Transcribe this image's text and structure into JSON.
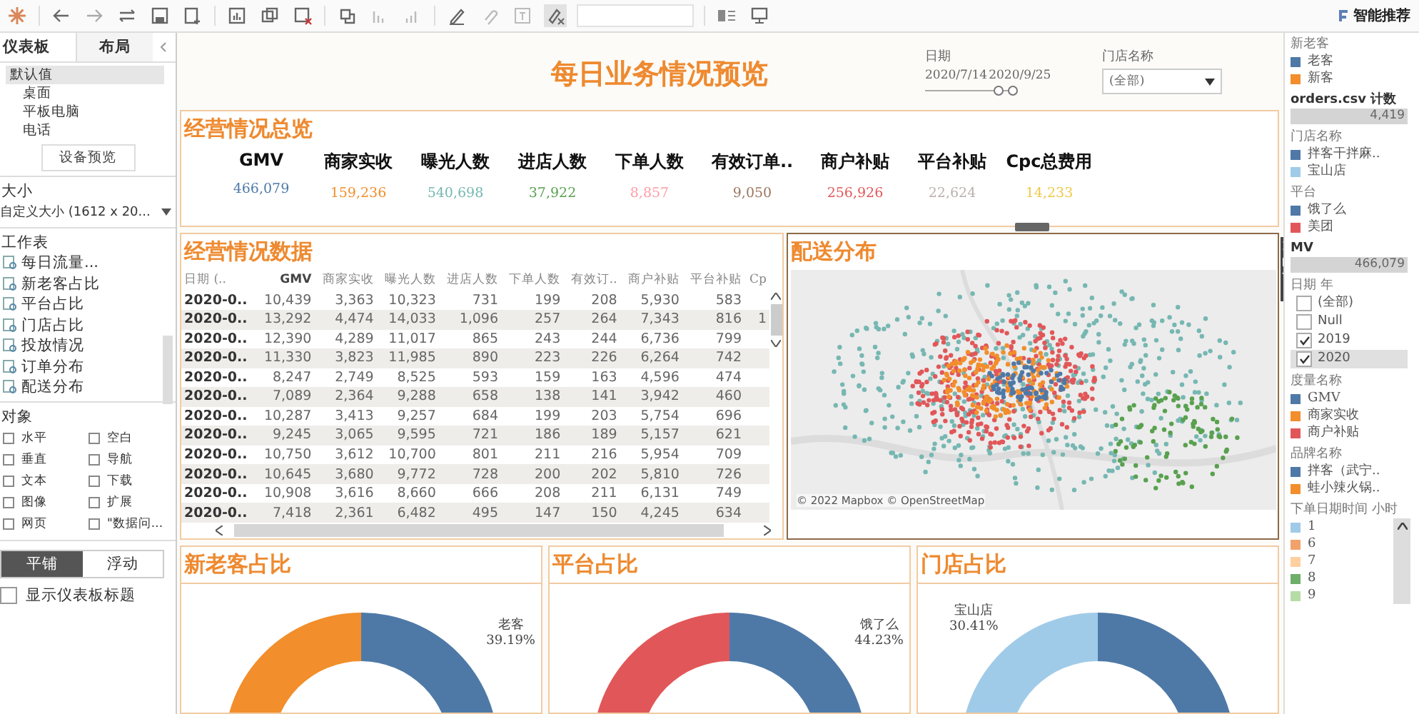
{
  "toolbar": {
    "recommend_button": "智能推荐"
  },
  "left_panel": {
    "tabs": [
      {
        "label": "仪表板",
        "selected": true
      },
      {
        "label": "布局",
        "selected": false
      }
    ],
    "devices": [
      {
        "label": "默认值",
        "selected": true
      },
      {
        "label": "桌面",
        "selected": false
      },
      {
        "label": "平板电脑",
        "selected": false
      },
      {
        "label": "电话",
        "selected": false
      }
    ],
    "preview_button": "设备预览",
    "size_label": "大小",
    "size_value": "自定义大小 (1612 x 20...",
    "sheets_label": "工作表",
    "sheets": [
      "每日流量...",
      "新老客占比",
      "平台占比",
      "门店占比",
      "投放情况",
      "订单分布",
      "配送分布"
    ],
    "objects_label": "对象",
    "objects": [
      "水平",
      "空白",
      "垂直",
      "导航",
      "文本",
      "下载",
      "图像",
      "扩展",
      "网页",
      "\"数据问..."
    ],
    "mode_tabs": [
      {
        "label": "平铺",
        "selected": true
      },
      {
        "label": "浮动",
        "selected": false
      }
    ],
    "show_title": {
      "label": "显示仪表板标题",
      "checked": false
    }
  },
  "dashboard": {
    "title": "每日业务情况预览",
    "date_filter": {
      "label": "日期",
      "start": "2020/7/14",
      "end": "2020/9/25",
      "thumbs": [
        {
          "level": 0.8
        },
        {
          "level": 0.95
        }
      ]
    },
    "store_filter": {
      "label": "门店名称",
      "value": "(全部)"
    },
    "overview": {
      "title": "经营情况总览",
      "kpis": [
        {
          "label": "GMV",
          "value": "466,079",
          "color": "#4e79a7"
        },
        {
          "label": "商家实收",
          "value": "159,236",
          "color": "#f28e2b"
        },
        {
          "label": "曝光人数",
          "value": "540,698",
          "color": "#76b7b2"
        },
        {
          "label": "进店人数",
          "value": "37,922",
          "color": "#59a14f"
        },
        {
          "label": "下单人数",
          "value": "8,857",
          "color": "#ff9da7"
        },
        {
          "label": "有效订单..",
          "value": "9,050",
          "color": "#9c755f"
        },
        {
          "label": "商户补贴",
          "value": "256,926",
          "color": "#e15759"
        },
        {
          "label": "平台补贴",
          "value": "22,624",
          "color": "#bab0ac"
        },
        {
          "label": "Cpc总费用",
          "value": "14,233",
          "color": "#edc948"
        }
      ]
    },
    "table": {
      "title": "经营情况数据",
      "columns": [
        "日期 (..",
        "GMV",
        "商家实收",
        "曝光人数",
        "进店人数",
        "下单人数",
        "有效订..",
        "商户补贴",
        "平台补贴",
        "Cp"
      ],
      "rows": [
        [
          "2020-0..",
          "10,439",
          "3,363",
          "10,323",
          "731",
          "199",
          "208",
          "5,930",
          "583"
        ],
        [
          "2020-0..",
          "13,292",
          "4,474",
          "14,033",
          "1,096",
          "257",
          "264",
          "7,343",
          "816",
          "1"
        ],
        [
          "2020-0..",
          "12,390",
          "4,289",
          "11,017",
          "865",
          "243",
          "244",
          "6,736",
          "799"
        ],
        [
          "2020-0..",
          "11,330",
          "3,823",
          "11,985",
          "890",
          "223",
          "226",
          "6,264",
          "742"
        ],
        [
          "2020-0..",
          "8,247",
          "2,749",
          "8,525",
          "593",
          "159",
          "163",
          "4,596",
          "474"
        ],
        [
          "2020-0..",
          "7,089",
          "2,364",
          "9,288",
          "658",
          "138",
          "141",
          "3,942",
          "460"
        ],
        [
          "2020-0..",
          "10,287",
          "3,413",
          "9,257",
          "684",
          "199",
          "203",
          "5,754",
          "696"
        ],
        [
          "2020-0..",
          "9,245",
          "3,065",
          "9,595",
          "721",
          "186",
          "189",
          "5,157",
          "621"
        ],
        [
          "2020-0..",
          "10,750",
          "3,612",
          "10,700",
          "801",
          "211",
          "216",
          "5,954",
          "709"
        ],
        [
          "2020-0..",
          "10,645",
          "3,680",
          "9,772",
          "728",
          "200",
          "202",
          "5,810",
          "726"
        ],
        [
          "2020-0..",
          "10,908",
          "3,616",
          "8,660",
          "666",
          "208",
          "211",
          "6,131",
          "749"
        ],
        [
          "2020-0..",
          "7,418",
          "2,361",
          "6,482",
          "495",
          "147",
          "150",
          "4,245",
          "634"
        ]
      ]
    },
    "map": {
      "title": "配送分布",
      "attribution": "© 2022 Mapbox © OpenStreetMap"
    },
    "donuts": [
      {
        "title": "新老客占比",
        "segments": [
          {
            "color": "#f28e2b"
          },
          {
            "color": "#4e79a7",
            "label": "老客",
            "percent": "39.19%"
          }
        ]
      },
      {
        "title": "平台占比",
        "segments": [
          {
            "color": "#e15759"
          },
          {
            "color": "#4e79a7",
            "label": "饿了么",
            "percent": "44.23%"
          }
        ]
      },
      {
        "title": "门店占比",
        "segments": [
          {
            "color": "#a0cbe8",
            "label": "宝山店",
            "percent": "30.41%"
          },
          {
            "color": "#4e79a7"
          }
        ]
      }
    ]
  },
  "right_panel": [
    {
      "kind": "legend",
      "title": "新老客",
      "items": [
        {
          "label": "老客",
          "color": "#4e79a7"
        },
        {
          "label": "新客",
          "color": "#f28e2b"
        }
      ]
    },
    {
      "kind": "bar",
      "title": "orders.csv 计数",
      "value": "4,419"
    },
    {
      "kind": "legend",
      "title": "门店名称",
      "items": [
        {
          "label": "拌客干拌麻..",
          "color": "#4e79a7"
        },
        {
          "label": "宝山店",
          "color": "#a0cbe8"
        }
      ]
    },
    {
      "kind": "legend",
      "title": "平台",
      "items": [
        {
          "label": "饿了么",
          "color": "#4e79a7"
        },
        {
          "label": "美团",
          "color": "#e15759"
        }
      ]
    },
    {
      "kind": "bar",
      "title": "MV",
      "value": "466,079"
    },
    {
      "kind": "checklist",
      "title": "日期 年",
      "items": [
        {
          "label": "(全部)",
          "checked": false,
          "selected": false
        },
        {
          "label": "Null",
          "checked": false,
          "selected": false
        },
        {
          "label": "2019",
          "checked": true,
          "selected": false
        },
        {
          "label": "2020",
          "checked": true,
          "selected": true
        }
      ]
    },
    {
      "kind": "legend",
      "title": "度量名称",
      "items": [
        {
          "label": "GMV",
          "color": "#4e79a7"
        },
        {
          "label": "商家实收",
          "color": "#f28e2b"
        },
        {
          "label": "商户补贴",
          "color": "#e15759"
        }
      ]
    },
    {
      "kind": "legend",
      "title": "品牌名称",
      "items": [
        {
          "label": "拌客（武宁..",
          "color": "#4e79a7"
        },
        {
          "label": "蛙小辣火锅..",
          "color": "#f28e2b"
        }
      ]
    },
    {
      "kind": "legend",
      "title": "下单日期时间 小时",
      "scroll": true,
      "items": [
        {
          "label": "1",
          "color": "#a0cbe8"
        },
        {
          "label": "6",
          "color": "#f1a26b"
        },
        {
          "label": "7",
          "color": "#ffcfa0"
        },
        {
          "label": "8",
          "color": "#6fae6a"
        },
        {
          "label": "9",
          "color": "#b5dda5"
        }
      ]
    }
  ]
}
